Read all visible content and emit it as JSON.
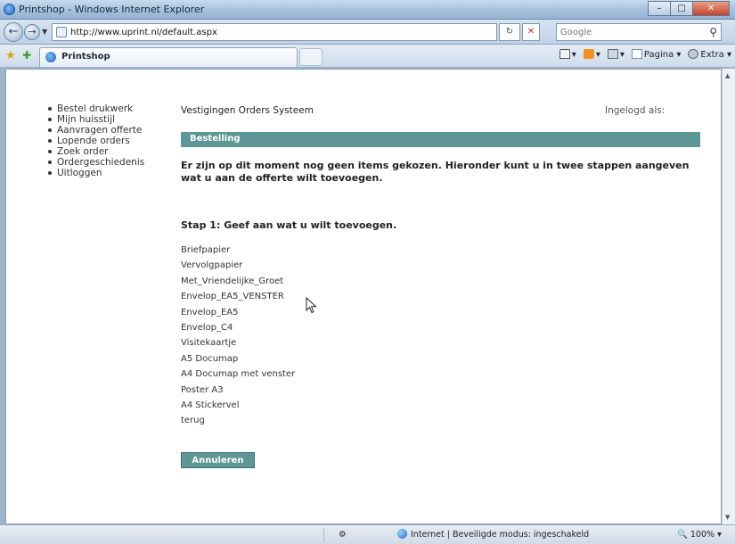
{
  "window": {
    "title": "Printshop - Windows Internet Explorer",
    "minimize": "–",
    "maximize": "□",
    "close": "✕"
  },
  "addressbar": {
    "back_icon": "←",
    "forward_icon": "→",
    "url": "http://www.uprint.nl/default.aspx",
    "refresh_icon": "↻",
    "stop_icon": "✕",
    "search_placeholder": "Google",
    "search_icon": "⚲"
  },
  "tabbar": {
    "favorites_icon": "★",
    "add_favorite_icon": "✚",
    "tab_label": "Printshop",
    "commands": {
      "home": "▾",
      "feeds": "▾",
      "print": "▾",
      "page": "Pagina ▾",
      "tools": "Extra ▾"
    }
  },
  "sidebar": {
    "items": [
      "Bestel drukwerk",
      "Mijn huisstijl",
      "Aanvragen offerte",
      "Lopende orders",
      "Zoek order",
      "Ordergeschiedenis",
      "Uitloggen"
    ]
  },
  "main": {
    "system_title": "Vestigingen Orders Systeem",
    "logged_in": "Ingelogd als:",
    "section_title": "Bestelling",
    "notice": "Er zijn op dit moment nog geen items gekozen. Hieronder kunt u in twee stappen aangeven wat u aan de offerte wilt toevoegen.",
    "step_heading": "Stap 1: Geef aan wat u wilt toevoegen.",
    "products": [
      "Briefpapier",
      "Vervolgpapier",
      "Met_Vriendelijke_Groet",
      "Envelop_EA5_VENSTER",
      "Envelop_EA5",
      "Envelop_C4",
      "Visitekaartje",
      "A5 Documap",
      "A4 Documap met venster",
      "Poster A3",
      "A4 Stickervel",
      "terug"
    ],
    "submit_label": "Annuleren"
  },
  "statusbar": {
    "zone": "Internet | Beveiligde modus: ingeschakeld",
    "zoom": "100%"
  }
}
